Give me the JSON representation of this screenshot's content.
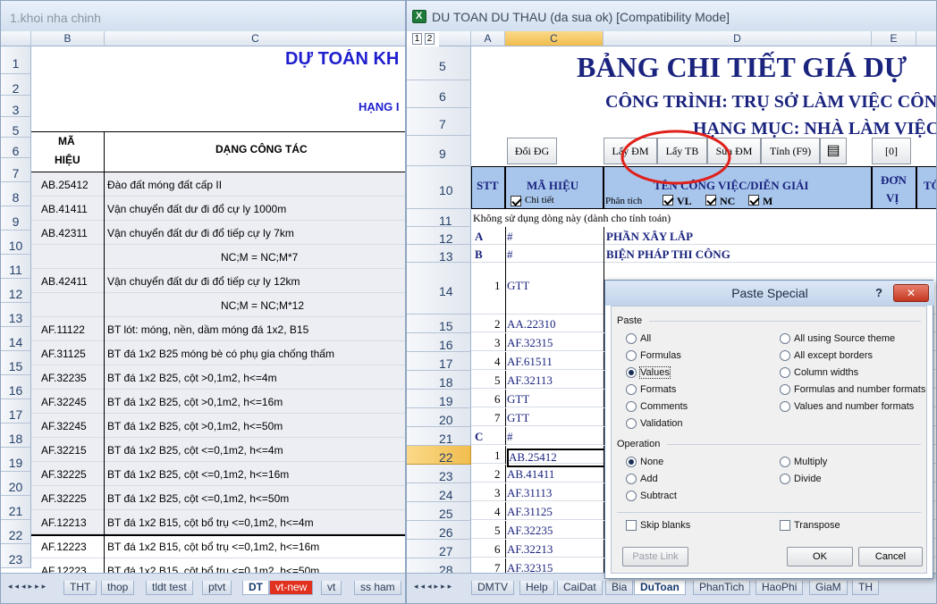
{
  "left_window": {
    "title": "1.khoi nha chinh",
    "col_b": "B",
    "col_c": "C",
    "header_title": "DỰ TOÁN KH",
    "header_sub": "HẠNG I",
    "ma_hieu_1": "MÃ",
    "ma_hieu_2": "HIỆU",
    "dang_cong_tac": "DẠNG CÔNG TÁC",
    "row_numbers": [
      "1",
      "2",
      "3",
      "5",
      "6",
      "7",
      "8",
      "9",
      "10",
      "11",
      "12",
      "13",
      "14",
      "15",
      "16",
      "17",
      "18",
      "19",
      "20",
      "21",
      "22",
      "23"
    ],
    "rows": [
      {
        "code": "AB.25412",
        "desc": "Đào đất móng đất cấp II"
      },
      {
        "code": "AB.41411",
        "desc": "Vận chuyển đất dư đi đổ cự ly 1000m"
      },
      {
        "code": "AB.42311",
        "desc": "Vận chuyển đất dư đi đổ tiếp cự ly 7km"
      },
      {
        "code": "",
        "desc": "NC;M = NC;M*7"
      },
      {
        "code": "AB.42411",
        "desc": "Vận chuyển đất dư đi đổ tiếp cự ly 12km"
      },
      {
        "code": "",
        "desc": "NC;M = NC;M*12"
      },
      {
        "code": "AF.11122",
        "desc": "BT lót: móng, nền, dầm móng đá 1x2, B15"
      },
      {
        "code": "AF.31125",
        "desc": "BT đá 1x2 B25 móng bè có phụ gia chống thấm"
      },
      {
        "code": "AF.32235",
        "desc": "BT đá 1x2 B25, cột >0,1m2, h<=4m"
      },
      {
        "code": "AF.32245",
        "desc": "BT đá 1x2 B25, cột >0,1m2, h<=16m"
      },
      {
        "code": "AF.32245",
        "desc": "BT đá 1x2 B25, cột >0,1m2, h<=50m"
      },
      {
        "code": "AF.32215",
        "desc": "BT đá 1x2 B25, cột <=0,1m2, h<=4m"
      },
      {
        "code": "AF.32225",
        "desc": "BT đá 1x2 B25, cột <=0,1m2, h<=16m"
      },
      {
        "code": "AF.32225",
        "desc": "BT đá 1x2 B25, cột <=0,1m2, h<=50m"
      },
      {
        "code": "AF.12213",
        "desc": "BT đá 1x2 B15, cột bổ trụ <=0,1m2, h<=4m"
      },
      {
        "code": "AF.12223",
        "desc": "BT đá 1x2 B15, cột bổ trụ <=0,1m2, h<=16m"
      },
      {
        "code": "AF.12223",
        "desc": "BT đá 1x2 B15, cột bổ trụ <=0,1m2, h<=50m"
      }
    ],
    "tabs": [
      "THT",
      "thop",
      "tldt test",
      "ptvt",
      "DT",
      "vt-new",
      "vt",
      "ss ham"
    ]
  },
  "right_window": {
    "title": "DU TOAN DU THAU (da sua ok)  [Compatibility Mode]",
    "pane_buttons": [
      "1",
      "2"
    ],
    "cols": [
      "A",
      "C",
      "D",
      "E"
    ],
    "title_big": "BẢNG CHI TIẾT GIÁ DỰ",
    "cong_trinh": "CÔNG TRÌNH: TRỤ SỞ LÀM VIỆC CÔN",
    "hang_muc": "HẠNG MỤC: NHÀ LÀM VIỆC",
    "buttons": [
      "Đổi ĐG",
      "Lấy ĐM",
      "Lấy TB",
      "Sửa ĐM",
      "Tính (F9)",
      "[0]"
    ],
    "hdr_stt": "STT",
    "hdr_ma_hieu": "MÃ HIỆU",
    "hdr_chi_tiet": "Chi tiết",
    "hdr_ten": "TÊN CÔNG VIỆC/DIỄN GIẢI",
    "hdr_phan_tich": "Phân tích",
    "hdr_vl": "VL",
    "hdr_nc": "NC",
    "hdr_m": "M",
    "hdr_don": "ĐƠN",
    "hdr_vi": "VỊ",
    "hdr_to": "TỔ",
    "row_numbers": [
      "5",
      "6",
      "7",
      "9",
      "10",
      "11",
      "12",
      "13",
      "14",
      "15",
      "16",
      "17",
      "18",
      "19",
      "20",
      "21",
      "22",
      "23",
      "24",
      "25",
      "26",
      "27",
      "28"
    ],
    "row11_text": "Không sử dụng dòng này (dành cho tính toán)",
    "rows": [
      {
        "stt": "A",
        "code": "#",
        "name": "PHẦN XÂY LẮP"
      },
      {
        "stt": "B",
        "code": "#",
        "name": "BIỆN PHÁP THI CÔNG"
      },
      {
        "stt": "1",
        "code": "GTT",
        "name": ""
      },
      {
        "stt": "2",
        "code": "AA.22310",
        "name": ""
      },
      {
        "stt": "3",
        "code": "AF.32315",
        "name": ""
      },
      {
        "stt": "4",
        "code": "AF.61511",
        "name": ""
      },
      {
        "stt": "5",
        "code": "AF.32113",
        "name": ""
      },
      {
        "stt": "6",
        "code": "GTT",
        "name": ""
      },
      {
        "stt": "7",
        "code": "GTT",
        "name": ""
      },
      {
        "stt": "C",
        "code": "#",
        "name": ""
      },
      {
        "stt": "1",
        "code": "AB.25412",
        "name": ""
      },
      {
        "stt": "2",
        "code": "AB.41411",
        "name": ""
      },
      {
        "stt": "3",
        "code": "AF.31113",
        "name": ""
      },
      {
        "stt": "4",
        "code": "AF.31125",
        "name": ""
      },
      {
        "stt": "5",
        "code": "AF.32235",
        "name": ""
      },
      {
        "stt": "6",
        "code": "AF.32213",
        "name": ""
      },
      {
        "stt": "7",
        "code": "AF.32315",
        "name": ""
      }
    ],
    "tabs": [
      "DMTV",
      "Help",
      "CaiDat",
      "Bia",
      "DuToan",
      "PhanTich",
      "HaoPhi",
      "GiaM",
      "TH"
    ]
  },
  "dialog": {
    "title": "Paste Special",
    "help": "?",
    "close": "✕",
    "paste_label": "Paste",
    "paste_left": [
      "All",
      "Formulas",
      "Values",
      "Formats",
      "Comments",
      "Validation"
    ],
    "paste_right": [
      "All using Source theme",
      "All except borders",
      "Column widths",
      "Formulas and number formats",
      "Values and number formats"
    ],
    "selected_paste": "Values",
    "operation_label": "Operation",
    "op_left": [
      "None",
      "Add",
      "Subtract"
    ],
    "op_right": [
      "Multiply",
      "Divide"
    ],
    "selected_op": "None",
    "skip_blanks": "Skip blanks",
    "transpose": "Transpose",
    "paste_link": "Paste Link",
    "ok": "OK",
    "cancel": "Cancel"
  },
  "colors": {
    "header_blue": "#1f1fcf",
    "title_navy": "#1a237e",
    "annotation_red": "#e0201a",
    "tab_red": "#e0301e",
    "selection": "#f1bd4e"
  }
}
